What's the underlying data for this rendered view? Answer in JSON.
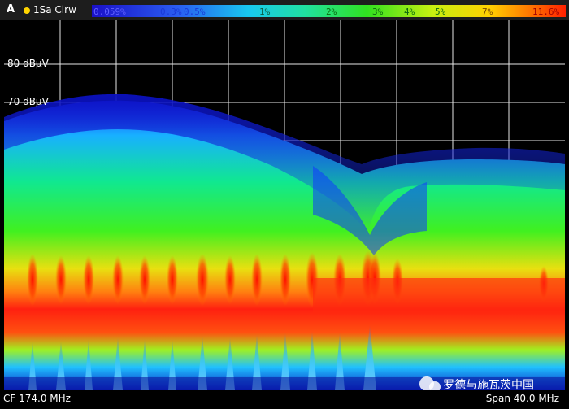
{
  "header": {
    "trace_letter": "A",
    "trace_label": "1Sa Clrw",
    "indicator_color": "#ffd400"
  },
  "color_scale": {
    "ticks": [
      "0.059%",
      "0.3%",
      "0.5%",
      "1%",
      "2%",
      "3%",
      "4%",
      "5%",
      "7%",
      "11.6%"
    ]
  },
  "y_axis": {
    "labels": [
      "80 dBµV",
      "70 dBµV"
    ]
  },
  "footer": {
    "center_frequency": "CF 174.0 MHz",
    "span": "Span 40.0 MHz"
  },
  "watermark": {
    "text": "罗德与施瓦茨中国"
  }
}
